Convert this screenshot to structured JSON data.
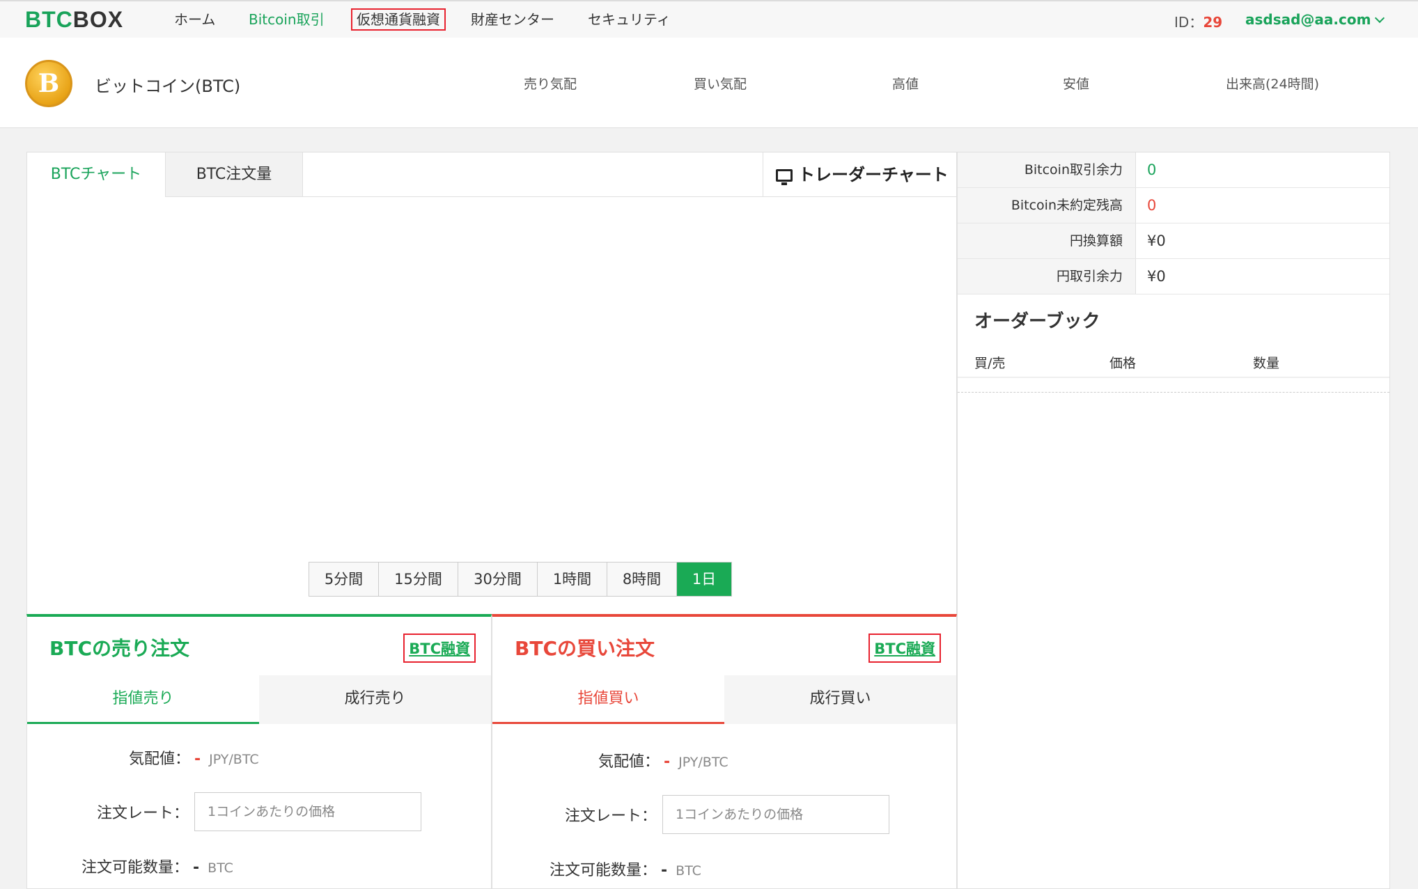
{
  "nav": {
    "logo_part1": "BTC",
    "logo_part2": "BOX",
    "home": "ホーム",
    "bitcoin_trade": "Bitcoin取引",
    "crypto_finance": "仮想通貨融資",
    "asset_center": "財産センター",
    "security": "セキュリティ",
    "id_label": "ID：",
    "id_value": "29",
    "user_email": "asdsad@aa.com"
  },
  "ticker": {
    "coin_symbol": "B",
    "coin_name": "ビットコイン(BTC)",
    "ask": "売り気配",
    "bid": "買い気配",
    "high": "高値",
    "low": "安値",
    "volume": "出来高(24時間)"
  },
  "chart": {
    "tab_chart": "BTCチャート",
    "tab_orders": "BTC注文量",
    "trader_chart": "トレーダーチャート",
    "intervals": [
      "5分間",
      "15分間",
      "30分間",
      "1時間",
      "8時間",
      "1日"
    ],
    "selected_interval": "1日"
  },
  "balance": {
    "rows": [
      {
        "label": "Bitcoin取引余力",
        "value": "0",
        "color": "#19a35a"
      },
      {
        "label": "Bitcoin未約定残高",
        "value": "0",
        "color": "#e8473a"
      },
      {
        "label": "円換算額",
        "value": "¥0",
        "color": "#333333"
      },
      {
        "label": "円取引余力",
        "value": "¥0",
        "color": "#333333"
      }
    ]
  },
  "orderbook": {
    "title": "オーダーブック",
    "col_side": "買/売",
    "col_price": "価格",
    "col_qty": "数量"
  },
  "sell": {
    "title": "BTCの売り注文",
    "finance_link": "BTC融資",
    "tab_limit": "指値売り",
    "tab_market": "成行売り",
    "quote_label": "気配値：",
    "quote_value": "-",
    "quote_unit": "JPY/BTC",
    "rate_label": "注文レート：",
    "rate_placeholder": "1コインあたりの価格",
    "qty_label": "注文可能数量：",
    "qty_value": "-",
    "qty_unit": "BTC"
  },
  "buy": {
    "title": "BTCの買い注文",
    "finance_link": "BTC融資",
    "tab_limit": "指値買い",
    "tab_market": "成行買い",
    "quote_label": "気配値：",
    "quote_value": "-",
    "quote_unit": "JPY/BTC",
    "rate_label": "注文レート：",
    "rate_placeholder": "1コインあたりの価格",
    "qty_label": "注文可能数量：",
    "qty_value": "-",
    "qty_unit": "BTC"
  },
  "colors": {
    "brand_green": "#19a35a",
    "sell_green": "#1aaa55",
    "buy_red": "#e8473a",
    "highlight_box": "#e8212e"
  }
}
